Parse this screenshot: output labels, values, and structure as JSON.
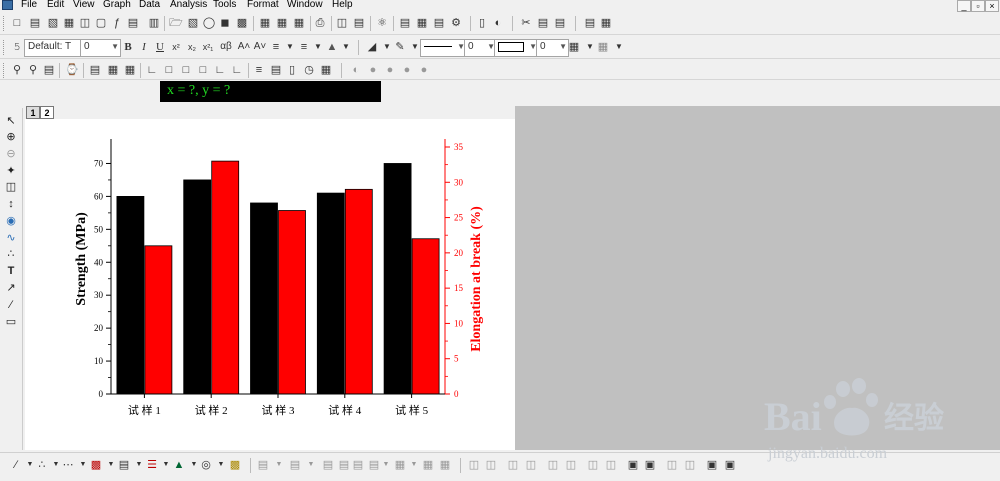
{
  "menu": [
    "File",
    "Edit",
    "View",
    "Graph",
    "Data",
    "Analysis",
    "Tools",
    "Format",
    "Window",
    "Help"
  ],
  "window_controls": [
    "_",
    "▫",
    "×"
  ],
  "format_bar": {
    "font_name": "Default: T",
    "font_size": "0",
    "bold": "B",
    "italic": "I",
    "underline": "U",
    "superscript": "x²",
    "subscript": "x₂",
    "supsub": "x²₁",
    "greek": "αβ",
    "increase_font": "A˄",
    "decrease_font": "A˅",
    "line_width": "0",
    "border_width": "0"
  },
  "status_text": "x = ?, y = ?",
  "layer_tabs": [
    "1",
    "2"
  ],
  "colors": {
    "series1": "#000000",
    "series2": "#ff0000",
    "page_bg": "#ffffff",
    "workspace": "#c0c0c0",
    "status_bg": "#000000",
    "status_fg": "#22dd22"
  },
  "icons": {
    "toolbar1": [
      "new-project-icon",
      "new-worksheet-icon",
      "new-graph-icon",
      "new-matrix-icon",
      "new-excel-icon",
      "new-layout-icon",
      "new-function-icon",
      "new-notes-icon",
      "open-icon",
      "open-template-icon",
      "import-icon",
      "save-icon",
      "save-template-icon",
      "export-icon",
      "recalculate-icon",
      "print-icon",
      "refresh-icon",
      "duplicate-icon",
      "project-explorer-icon",
      "results-log-icon",
      "script-window-icon",
      "code-builder-icon",
      "command-window-icon",
      "add-column-icon",
      "layer-management-icon",
      "zoom-extents-icon",
      "merge-icon",
      "arrange-icon"
    ],
    "toolbar3": [
      "rescale-icon",
      "zoom-icon",
      "new-layer-icon",
      "extract-icon",
      "layout-icon",
      "axes-L-icon",
      "axes-box-icon",
      "axes-frame-icon",
      "axes-right-icon",
      "axes-top-icon",
      "axes-TR-icon",
      "grid-icon",
      "legend-icon",
      "colorscale-icon",
      "timestamp-icon",
      "table-icon",
      "lighting-icon",
      "rotate-icon",
      "tilt-icon",
      "perspective-icon",
      "reset-icon"
    ],
    "tools": [
      "pointer-icon",
      "zoom-in-icon",
      "zoom-out-icon",
      "screen-reader-icon",
      "data-reader-icon",
      "data-selector-icon",
      "mask-icon",
      "draw-data-icon",
      "region-icon",
      "text-tool-icon",
      "arrow-tool-icon",
      "line-tool-icon",
      "rectangle-tool-icon"
    ],
    "bottom": [
      "line-plot-icon",
      "scatter-plot-icon",
      "line-symbol-icon",
      "column-plot-icon",
      "pie-chart-icon",
      "area-plot-icon",
      "contour-plot-icon",
      "polar-plot-icon",
      "3d-plot-icon"
    ]
  },
  "chart_data": {
    "type": "bar",
    "categories": [
      "试 样 1",
      "试 样 2",
      "试 样 3",
      "试 样 4",
      "试 样 5"
    ],
    "series": [
      {
        "name": "Strength (MPa)",
        "axis": "left",
        "color": "#000000",
        "values": [
          60,
          65,
          58,
          61,
          70
        ]
      },
      {
        "name": "Elongation at break (%)",
        "axis": "right",
        "color": "#ff0000",
        "values": [
          21,
          33,
          26,
          29,
          22
        ]
      }
    ],
    "ylabel": "Strength (MPa)",
    "ylim": [
      0,
      75
    ],
    "yticks": [
      0,
      10,
      20,
      30,
      40,
      50,
      60,
      70
    ],
    "y2label": "Elongation at break (%)",
    "y2lim": [
      0,
      35
    ],
    "y2ticks": [
      0,
      5,
      10,
      15,
      20,
      25,
      30,
      35
    ],
    "grid": false,
    "legend": "none"
  },
  "watermark": {
    "brand": "Bai",
    "brand_cn": "经验",
    "url": "jingyan.baidu.com"
  }
}
